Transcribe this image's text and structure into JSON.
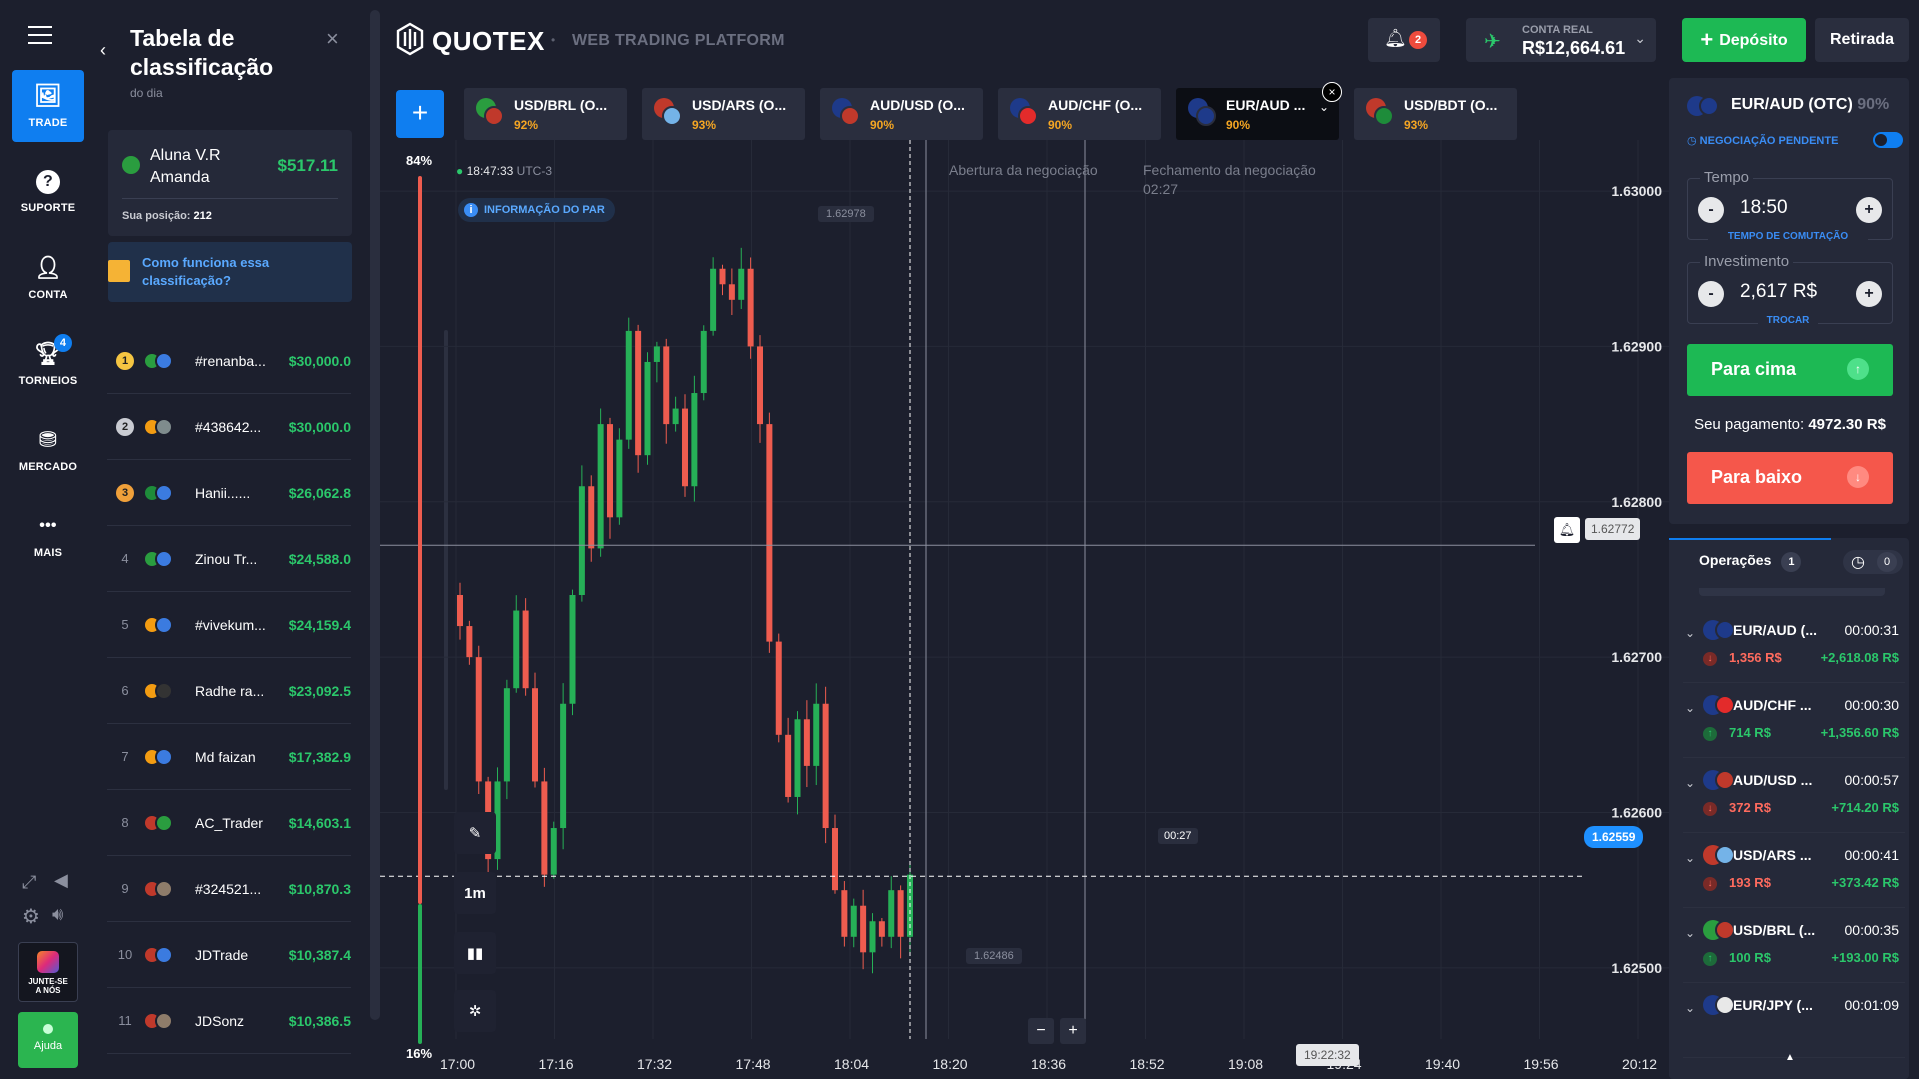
{
  "nav": {
    "items": [
      {
        "label": "TRADE",
        "icon": "chart-image-icon"
      },
      {
        "label": "SUPORTE",
        "icon": "help-icon"
      },
      {
        "label": "CONTA",
        "icon": "user-icon"
      },
      {
        "label": "TORNEIOS",
        "icon": "trophy-icon",
        "badge": "4"
      },
      {
        "label": "MERCADO",
        "icon": "coins-icon"
      },
      {
        "label": "MAIS",
        "icon": "more-icon"
      }
    ],
    "join_label_1": "JUNTE-SE",
    "join_label_2": "A NÓS",
    "help_label": "Ajuda"
  },
  "leaderboard": {
    "title_1": "Tabela de",
    "title_2": "classificação",
    "subtitle": "do dia",
    "user_name_1": "Aluna V.R",
    "user_name_2": "Amanda",
    "user_amount": "$517.11",
    "position_label": "Sua posição:",
    "position_value": "212",
    "how_1": "Como funciona essa",
    "how_2": "classificação?",
    "rows": [
      {
        "rank": "1",
        "name": "#renanba...",
        "amount": "$30,000.0",
        "c1": "#2a9d3f",
        "c2": "#3b7be0"
      },
      {
        "rank": "2",
        "name": "#438642...",
        "amount": "$30,000.0",
        "c1": "#f39c12",
        "c2": "#7f8c8d"
      },
      {
        "rank": "3",
        "name": "Hanii......",
        "amount": "$26,062.8",
        "c1": "#1e8c3a",
        "c2": "#3b7be0"
      },
      {
        "rank": "4",
        "name": "Zinou Tr...",
        "amount": "$24,588.0",
        "c1": "#2a9d3f",
        "c2": "#3b7be0"
      },
      {
        "rank": "5",
        "name": "#vivekum...",
        "amount": "$24,159.4",
        "c1": "#f39c12",
        "c2": "#3b7be0"
      },
      {
        "rank": "6",
        "name": "Radhe ra...",
        "amount": "$23,092.5",
        "c1": "#f39c12",
        "c2": "#333"
      },
      {
        "rank": "7",
        "name": "Md faizan",
        "amount": "$17,382.9",
        "c1": "#f39c12",
        "c2": "#3b7be0"
      },
      {
        "rank": "8",
        "name": "AC_Trader",
        "amount": "$14,603.1",
        "c1": "#c0392b",
        "c2": "#2a9d3f"
      },
      {
        "rank": "9",
        "name": "#324521...",
        "amount": "$10,870.3",
        "c1": "#c0392b",
        "c2": "#8e7c6a"
      },
      {
        "rank": "10",
        "name": "JDTrade",
        "amount": "$10,387.4",
        "c1": "#c0392b",
        "c2": "#3b7be0"
      },
      {
        "rank": "11",
        "name": "JDSonz",
        "amount": "$10,386.5",
        "c1": "#c0392b",
        "c2": "#8e7c6a"
      }
    ]
  },
  "topbar": {
    "brand": "QUOTEX",
    "tagline": "WEB TRADING PLATFORM",
    "notifications": "2",
    "account_label": "CONTA REAL",
    "balance": "R$12,664.61",
    "deposit": "Depósito",
    "withdraw": "Retirada"
  },
  "tabs": [
    {
      "symbol": "USD/BRL (O...",
      "pct": "92%",
      "c1": "#2a9d3f",
      "c2": "#c0392b"
    },
    {
      "symbol": "USD/ARS (O...",
      "pct": "93%",
      "c1": "#c0392b",
      "c2": "#74b3e8"
    },
    {
      "symbol": "AUD/USD (O...",
      "pct": "90%",
      "c1": "#1e3a8a",
      "c2": "#c0392b"
    },
    {
      "symbol": "AUD/CHF (O...",
      "pct": "90%",
      "c1": "#1e3a8a",
      "c2": "#e32b2b"
    },
    {
      "symbol": "EUR/AUD ...",
      "pct": "90%",
      "c1": "#1e3a8a",
      "c2": "#1e3a8a"
    },
    {
      "symbol": "USD/BDT (O...",
      "pct": "93%",
      "c1": "#c0392b",
      "c2": "#1e8c3a"
    }
  ],
  "chart_labels": {
    "time": "18:47:33",
    "tz": "UTC-3",
    "pair_info": "INFORMAÇÃO DO PAR",
    "open_label": "Abertura da negociação",
    "close_label": "Fechamento da negociação",
    "close_time": "02:27",
    "high_label": "1.62978",
    "low_label": "1.62486",
    "crosshair_price": "1.62772",
    "current_price": "1.62559",
    "countdown": "00:27",
    "crosshair_time": "19:22:32",
    "pct_up": "84%",
    "pct_down": "16%",
    "timeframe": "1m",
    "zoom_out": "−",
    "zoom_in": "+"
  },
  "chart_data": {
    "type": "candlestick",
    "y_ticks": [
      "1.63000",
      "1.62900",
      "1.62800",
      "1.62700",
      "1.62600",
      "1.62500"
    ],
    "y_tick_values": [
      1.63,
      1.629,
      1.628,
      1.627,
      1.626,
      1.625
    ],
    "x_ticks": [
      "17:00",
      "17:16",
      "17:32",
      "17:48",
      "18:04",
      "18:20",
      "18:36",
      "18:52",
      "19:08",
      "19:24",
      "19:40",
      "19:56",
      "20:12"
    ],
    "ylim": [
      1.6246,
      1.6302
    ],
    "close": [
      1.6272,
      1.627,
      1.6262,
      1.6257,
      1.6262,
      1.6268,
      1.6273,
      1.6268,
      1.6262,
      1.6256,
      1.6259,
      1.6267,
      1.6274,
      1.6281,
      1.6277,
      1.6285,
      1.6279,
      1.6284,
      1.6291,
      1.6283,
      1.6289,
      1.629,
      1.6285,
      1.6286,
      1.6281,
      1.6287,
      1.6291,
      1.6295,
      1.6294,
      1.6293,
      1.6295,
      1.629,
      1.6285,
      1.6271,
      1.6265,
      1.6261,
      1.6266,
      1.6263,
      1.6267,
      1.6259,
      1.6255,
      1.6252,
      1.6254,
      1.6251,
      1.6253,
      1.6252,
      1.6255,
      1.6252,
      1.6256
    ],
    "series_colors": {
      "up": "#26b057",
      "down": "#ee5c4f"
    }
  },
  "trade": {
    "pair": "EUR/AUD (OTC)",
    "pct": "90%",
    "pending_label": "NEGOCIAÇÃO PENDENTE",
    "time_label": "Tempo",
    "time_value": "18:50",
    "time_switch": "TEMPO DE COMUTAÇÃO",
    "invest_label": "Investimento",
    "invest_value": "2,617 R$",
    "invest_switch": "TROCAR",
    "up_label": "Para cima",
    "payout_label": "Seu pagamento:",
    "payout_value": "4972.30 R$",
    "down_label": "Para baixo",
    "minus": "-",
    "plus": "+"
  },
  "operations": {
    "tab_label": "Operações",
    "count": "1",
    "history_count": "0",
    "items": [
      {
        "pair": "EUR/AUD (...",
        "time": "00:00:31",
        "invest": "1,356 R$",
        "profit": "+2,618.08 R$",
        "dir": "down",
        "c1": "#1e3a8a",
        "c2": "#1e3a8a"
      },
      {
        "pair": "AUD/CHF ...",
        "time": "00:00:30",
        "invest": "714 R$",
        "profit": "+1,356.60 R$",
        "dir": "up",
        "c1": "#1e3a8a",
        "c2": "#e32b2b"
      },
      {
        "pair": "AUD/USD ...",
        "time": "00:00:57",
        "invest": "372 R$",
        "profit": "+714.20 R$",
        "dir": "down",
        "c1": "#1e3a8a",
        "c2": "#c0392b"
      },
      {
        "pair": "USD/ARS ...",
        "time": "00:00:41",
        "invest": "193 R$",
        "profit": "+373.42 R$",
        "dir": "down",
        "c1": "#c0392b",
        "c2": "#74b3e8"
      },
      {
        "pair": "USD/BRL (...",
        "time": "00:00:35",
        "invest": "100 R$",
        "profit": "+193.00 R$",
        "dir": "up",
        "c1": "#2a9d3f",
        "c2": "#c0392b"
      },
      {
        "pair": "EUR/JPY (...",
        "time": "00:01:09",
        "invest": "",
        "profit": "",
        "dir": "up",
        "c1": "#1e3a8a",
        "c2": "#e8e8e8"
      }
    ]
  }
}
